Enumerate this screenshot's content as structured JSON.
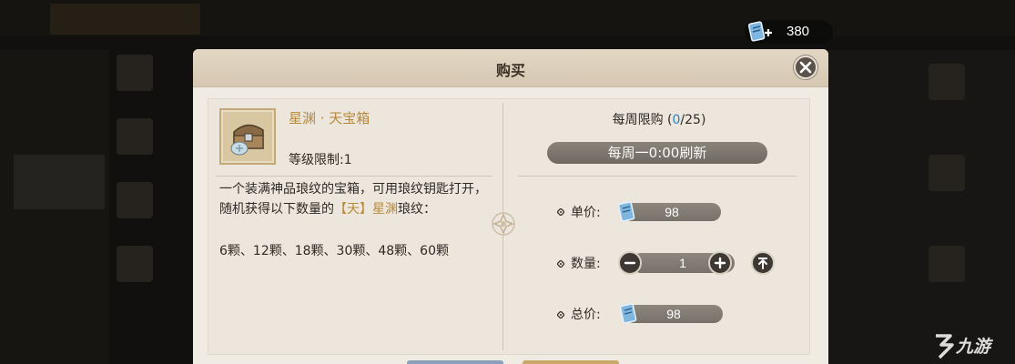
{
  "currency": {
    "icon": "scroll-ticket-plus-icon",
    "amount": "380"
  },
  "dialog": {
    "title": "购买",
    "close_icon": "close-icon",
    "item": {
      "icon": "treasure-chest-icon",
      "name": "星渊 · 天宝箱",
      "level_limit": "等级限制:1",
      "description_part1": "一个装满神品琅纹的宝箱，可用琅纹钥匙打开，随机获得以下数量的",
      "description_highlight": "【天】星渊",
      "description_part2": "琅纹：",
      "counts": "6颗、12颗、18颗、30颗、48颗、60颗"
    },
    "purchase": {
      "weekly_limit_prefix": "每周限购 (",
      "weekly_limit_used": "0",
      "weekly_limit_suffix": "/25)",
      "refresh_text": "每周一0:00刷新",
      "unit_price_label": "单价:",
      "unit_price": "98",
      "quantity_label": "数量:",
      "quantity": "1",
      "total_label": "总价:",
      "total_price": "98",
      "minus_icon": "minus-icon",
      "plus_icon": "plus-icon",
      "max_icon": "max-arrow-icon",
      "price_icon": "scroll-ticket-icon"
    }
  },
  "colors": {
    "accent_gold": "#b88a3a",
    "accent_blue": "#2f7fc2",
    "panel_bg": "#f1ece3"
  },
  "watermark": {
    "logo_icon": "jiuyou-logo-icon",
    "text": "九游"
  }
}
